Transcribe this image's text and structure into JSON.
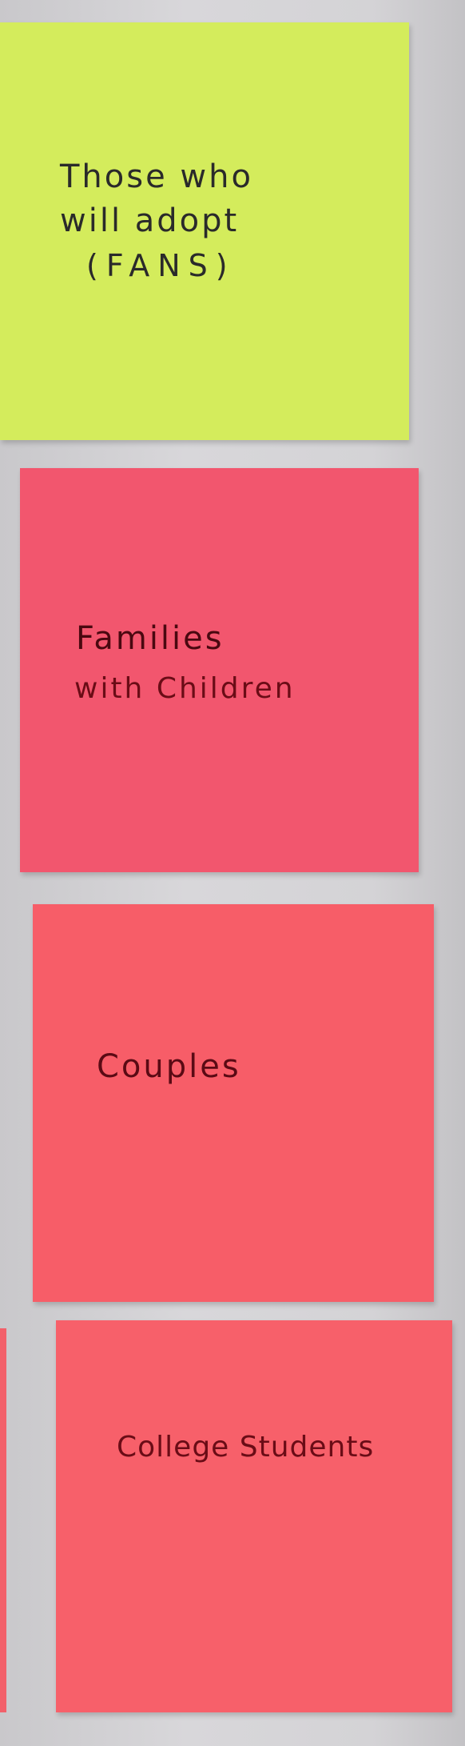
{
  "notes": [
    {
      "lines": [
        "Those who",
        "will adopt",
        "(FANS)"
      ],
      "color": "#d4ec5c",
      "ink": "#2a2a2a"
    },
    {
      "lines": [
        "Families",
        "with Children"
      ],
      "color": "#f2566e",
      "ink": "#5a0a14"
    },
    {
      "lines": [
        "Couples"
      ],
      "color": "#f75d68",
      "ink": "#5a0a14"
    },
    {
      "lines": [
        "College Students"
      ],
      "color": "#f7606a",
      "ink": "#6a0c16"
    }
  ]
}
